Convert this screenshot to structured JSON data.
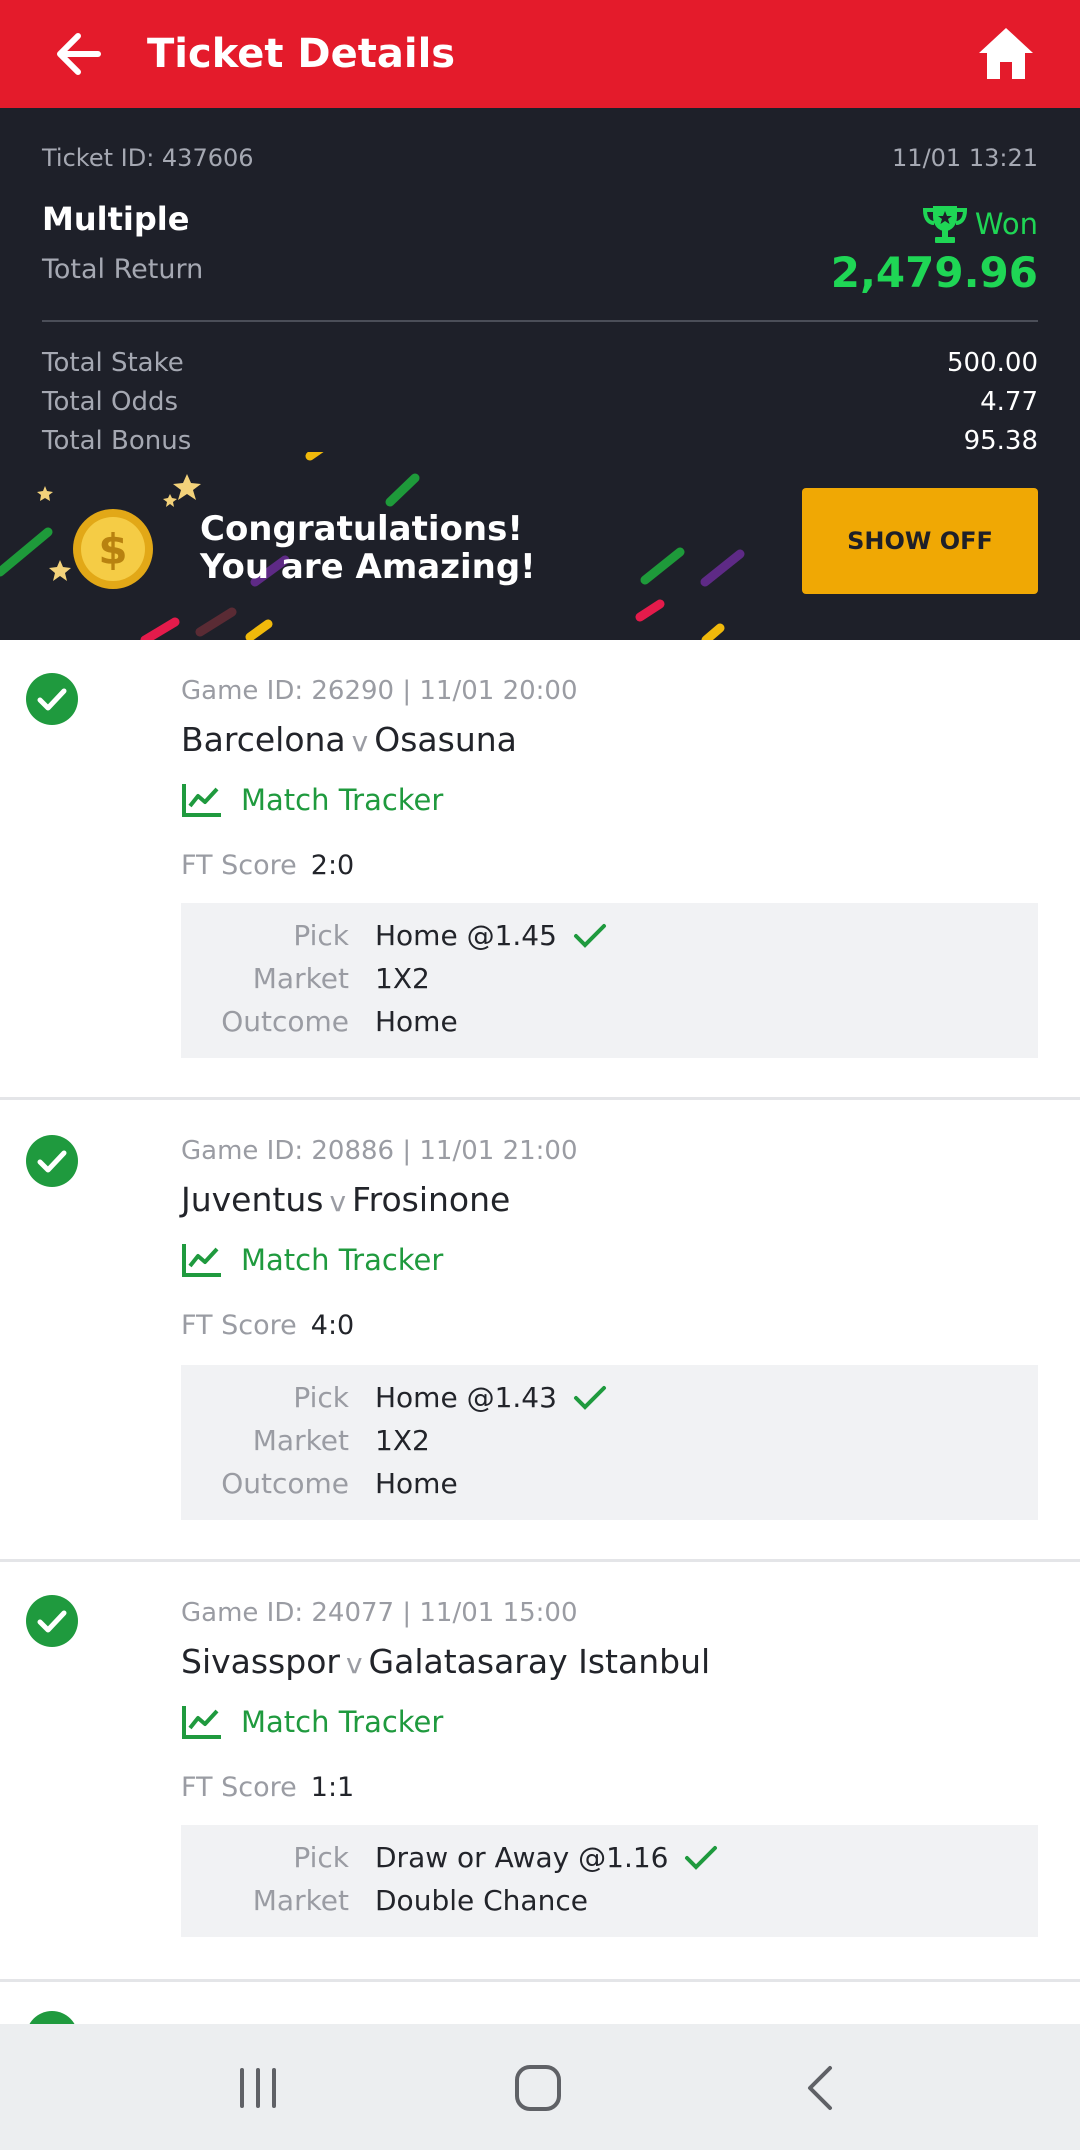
{
  "header": {
    "title": "Ticket Details"
  },
  "ticket": {
    "id_text": "Ticket ID: 437606",
    "datetime": "11/01 13:21",
    "bet_type": "Multiple",
    "status": "Won",
    "total_return_label": "Total Return",
    "total_return": "2,479.96",
    "total_stake_label": "Total Stake",
    "total_stake": "500.00",
    "total_odds_label": "Total Odds",
    "total_odds": "4.77",
    "total_bonus_label": "Total Bonus",
    "total_bonus": "95.38"
  },
  "banner": {
    "line1": "Congratulations!",
    "line2": "You are Amazing!",
    "button": "SHOW OFF"
  },
  "games": [
    {
      "meta": "Game ID: 26290 | 11/01 20:00",
      "home": "Barcelona",
      "vs": "v",
      "away": "Osasuna",
      "tracker": "Match Tracker",
      "ft_label": "FT Score",
      "ft_score": "2:0",
      "pick_label": "Pick",
      "pick": "Home @1.45",
      "market_label": "Market",
      "market": "1X2",
      "outcome_label": "Outcome",
      "outcome": "Home"
    },
    {
      "meta": "Game ID: 20886 | 11/01 21:00",
      "home": "Juventus",
      "vs": "v",
      "away": "Frosinone",
      "tracker": "Match Tracker",
      "ft_label": "FT Score",
      "ft_score": "4:0",
      "pick_label": "Pick",
      "pick": "Home @1.43",
      "market_label": "Market",
      "market": "1X2",
      "outcome_label": "Outcome",
      "outcome": "Home"
    },
    {
      "meta": "Game ID: 24077 | 11/01 15:00",
      "home": "Sivasspor",
      "vs": "v",
      "away": "Galatasaray Istanbul",
      "tracker": "Match Tracker",
      "ft_label": "FT Score",
      "ft_score": "1:1",
      "pick_label": "Pick",
      "pick": "Draw or Away @1.16",
      "market_label": "Market",
      "market": "Double Chance"
    }
  ],
  "colors": {
    "brand_red": "#e41b2b",
    "panel_dark": "#1e2029",
    "won_green": "#1fd655",
    "tracker_green": "#1f9a3e",
    "show_off_yellow": "#f0a804"
  },
  "icons": {
    "back": "arrow-left-icon",
    "home": "home-icon",
    "won": "trophy-icon",
    "coin": "dollar-coin-icon",
    "settled": "check-circle-icon",
    "tracker": "line-chart-icon",
    "pick_ok": "checkmark-icon",
    "nav_recent": "recent-apps-icon",
    "nav_home": "nav-home-icon",
    "nav_back": "nav-back-icon"
  }
}
